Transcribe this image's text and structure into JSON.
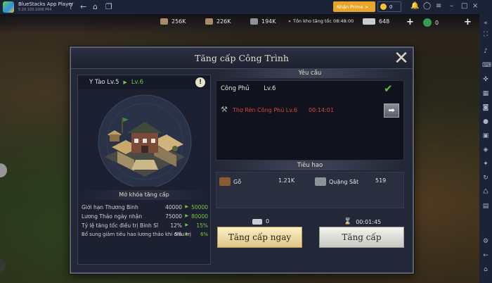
{
  "titlebar": {
    "app_name": "BlueStacks App Player",
    "version": "5.20.103.1006  P64",
    "prime_label": "Nhận Prime >",
    "coins": "0"
  },
  "resources": [
    {
      "value": "256K"
    },
    {
      "value": "226K"
    },
    {
      "value": "194K"
    },
    {
      "value": "Tồn kho tăng tốc 08:48:00"
    },
    {
      "value": "648"
    },
    {
      "value": "0"
    }
  ],
  "modal": {
    "title": "Tăng cấp Công Trình",
    "current_level": "Y Tào Lv.5",
    "next_level": "Lv.6",
    "unlock_heading": "Mở khóa tăng cấp",
    "stats": [
      {
        "label": "Giới hạn Thương Binh",
        "from": "40000",
        "to": "50000"
      },
      {
        "label": "Lương Thảo ngày nhận",
        "from": "75000",
        "to": "80000"
      },
      {
        "label": "Tỷ lệ tăng tốc điều trị Binh Sĩ",
        "from": "12%",
        "to": "15%"
      },
      {
        "label": "Bổ sung giảm tiêu hao lương thảo khi điều trị",
        "from": "5%",
        "to": "6%"
      }
    ],
    "requirements_heading": "Yêu cầu",
    "requirement_main": {
      "name": "Công Phủ",
      "level": "Lv.6"
    },
    "requirement_sub": {
      "name": "Thợ Rèn  Công Phủ Lv.6",
      "time": "00:14:01"
    },
    "cost_heading": "Tiêu hao",
    "costs": [
      {
        "name": "Gỗ",
        "amount": "1.21K",
        "icon": "wood-icon",
        "color": "#8a5a34"
      },
      {
        "name": "Quặng Sắt",
        "amount": "519",
        "icon": "iron-ore-icon",
        "color": "#8f9399"
      }
    ],
    "fast_cost": "0",
    "upgrade_time": "00:01:45",
    "fast_button": "Tăng cấp ngay",
    "upgrade_button": "Tăng cấp"
  },
  "colors": {
    "accent_green": "#73c846",
    "warning_red": "#d9463c",
    "gold": "#e9a52a"
  }
}
